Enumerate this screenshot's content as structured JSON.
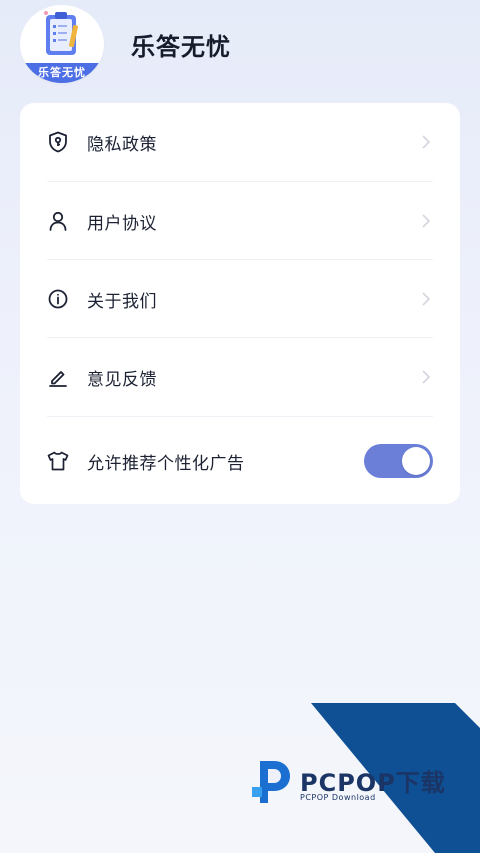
{
  "app": {
    "title": "乐答无忧",
    "logo_ribbon_text": "乐答无忧"
  },
  "menu": {
    "items": [
      {
        "label": "隐私政策",
        "icon": "shield-key-icon"
      },
      {
        "label": "用户协议",
        "icon": "user-icon"
      },
      {
        "label": "关于我们",
        "icon": "info-icon"
      },
      {
        "label": "意见反馈",
        "icon": "pencil-icon"
      }
    ],
    "ad_toggle": {
      "label": "允许推荐个性化广告",
      "icon": "shirt-icon",
      "enabled": true
    }
  },
  "watermark": {
    "brand": "PCPOP下载",
    "sub": "PCPOP Download"
  },
  "colors": {
    "accent": "#6b7fd9",
    "logo_blue": "#4d6fe6",
    "watermark_blue": "#0f4f93"
  }
}
